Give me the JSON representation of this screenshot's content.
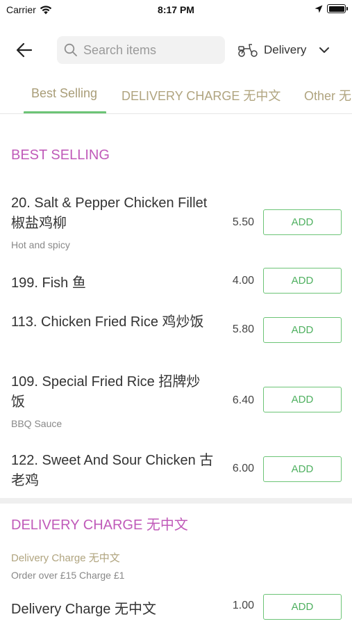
{
  "status_bar": {
    "carrier": "Carrier",
    "time": "8:17 PM",
    "icons": [
      "wifi-icon",
      "location-arrow-icon",
      "battery-icon"
    ]
  },
  "header": {
    "back_icon": "arrow-left-icon",
    "search": {
      "placeholder": "Search items",
      "value": ""
    },
    "order_type": {
      "icon": "scooter-icon",
      "label": "Delivery",
      "chevron": "chevron-down-icon"
    }
  },
  "tabs": [
    {
      "label": "Best Selling",
      "active": true
    },
    {
      "label": "DELIVERY CHARGE 无中文",
      "active": false
    },
    {
      "label": "Other 无",
      "active": false
    }
  ],
  "sections": [
    {
      "title": "BEST SELLING",
      "items": [
        {
          "name": "20. Salt & Pepper Chicken Fillet 椒盐鸡柳",
          "description": "Hot and spicy",
          "price": "5.50",
          "button": "ADD"
        },
        {
          "name": "199. Fish 鱼",
          "description": "",
          "price": "4.00",
          "button": "ADD"
        },
        {
          "name": "113. Chicken Fried Rice 鸡炒饭",
          "description": "",
          "price": "5.80",
          "button": "ADD"
        },
        {
          "name": "109. Special Fried Rice 招牌炒饭",
          "description": "BBQ Sauce",
          "price": "6.40",
          "button": "ADD"
        },
        {
          "name": "122. Sweet And Sour Chicken 古老鸡",
          "description": "",
          "price": "6.00",
          "button": "ADD"
        }
      ]
    },
    {
      "title": "DELIVERY CHARGE 无中文",
      "subtitle": "Delivery Charge 无中文",
      "note": "Order over £15 Charge £1",
      "items": [
        {
          "name": "Delivery Charge 无中文",
          "description": "",
          "price": "1.00",
          "button": "ADD"
        }
      ]
    }
  ],
  "colors": {
    "accent_green": "#6cc476",
    "section_title": "#c05ab9",
    "tab_text": "#b0a47f"
  }
}
